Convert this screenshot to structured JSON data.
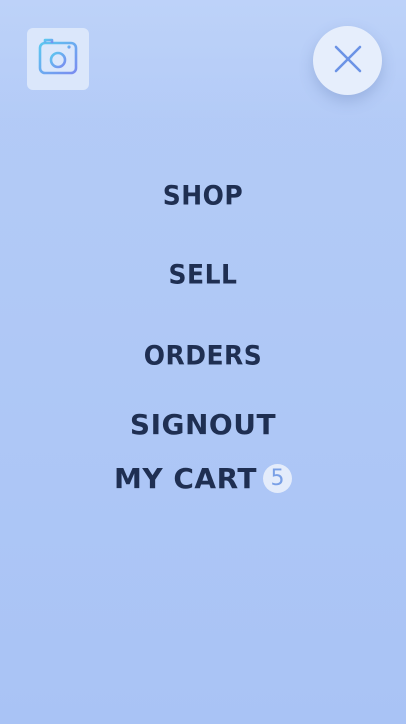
{
  "header": {
    "logo_icon": "camera-icon",
    "close_icon": "close-icon",
    "accent_gradient": [
      "#5cc8f0",
      "#7a8cf0"
    ],
    "close_color": "#6b93e6"
  },
  "menu": {
    "items": [
      {
        "label": "SHOP"
      },
      {
        "label": "SELL"
      },
      {
        "label": "ORDERS"
      },
      {
        "label": "SIGNOUT"
      },
      {
        "label": "MY CART"
      }
    ],
    "cart_count": "5"
  },
  "colors": {
    "background": "#afc8f6",
    "text": "#1f2f52"
  }
}
